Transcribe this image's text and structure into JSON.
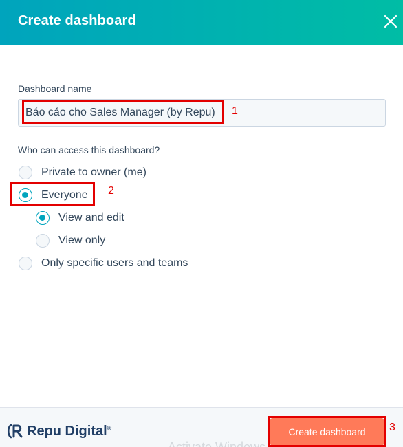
{
  "modal": {
    "title": "Create dashboard"
  },
  "form": {
    "name_label": "Dashboard name",
    "name_value": "Báo cáo cho Sales Manager (by Repu)",
    "access_label": "Who can access this dashboard?",
    "options": [
      {
        "label": "Private to owner (me)",
        "checked": false
      },
      {
        "label": "Everyone",
        "checked": true
      },
      {
        "label": "View and edit",
        "checked": true
      },
      {
        "label": "View only",
        "checked": false
      },
      {
        "label": "Only specific users and teams",
        "checked": false
      }
    ]
  },
  "annotations": {
    "one": "1",
    "two": "2",
    "three": "3"
  },
  "footer": {
    "logo_text": "Repu Digital",
    "logo_mark": "®",
    "watermark": "Activate Windows",
    "create_label": "Create dashboard"
  },
  "colors": {
    "header_start": "#00a4bd",
    "header_end": "#00bda5",
    "accent": "#00a4bd",
    "cta": "#ff7a59",
    "annotation": "#e30000",
    "brand": "#213f66"
  }
}
